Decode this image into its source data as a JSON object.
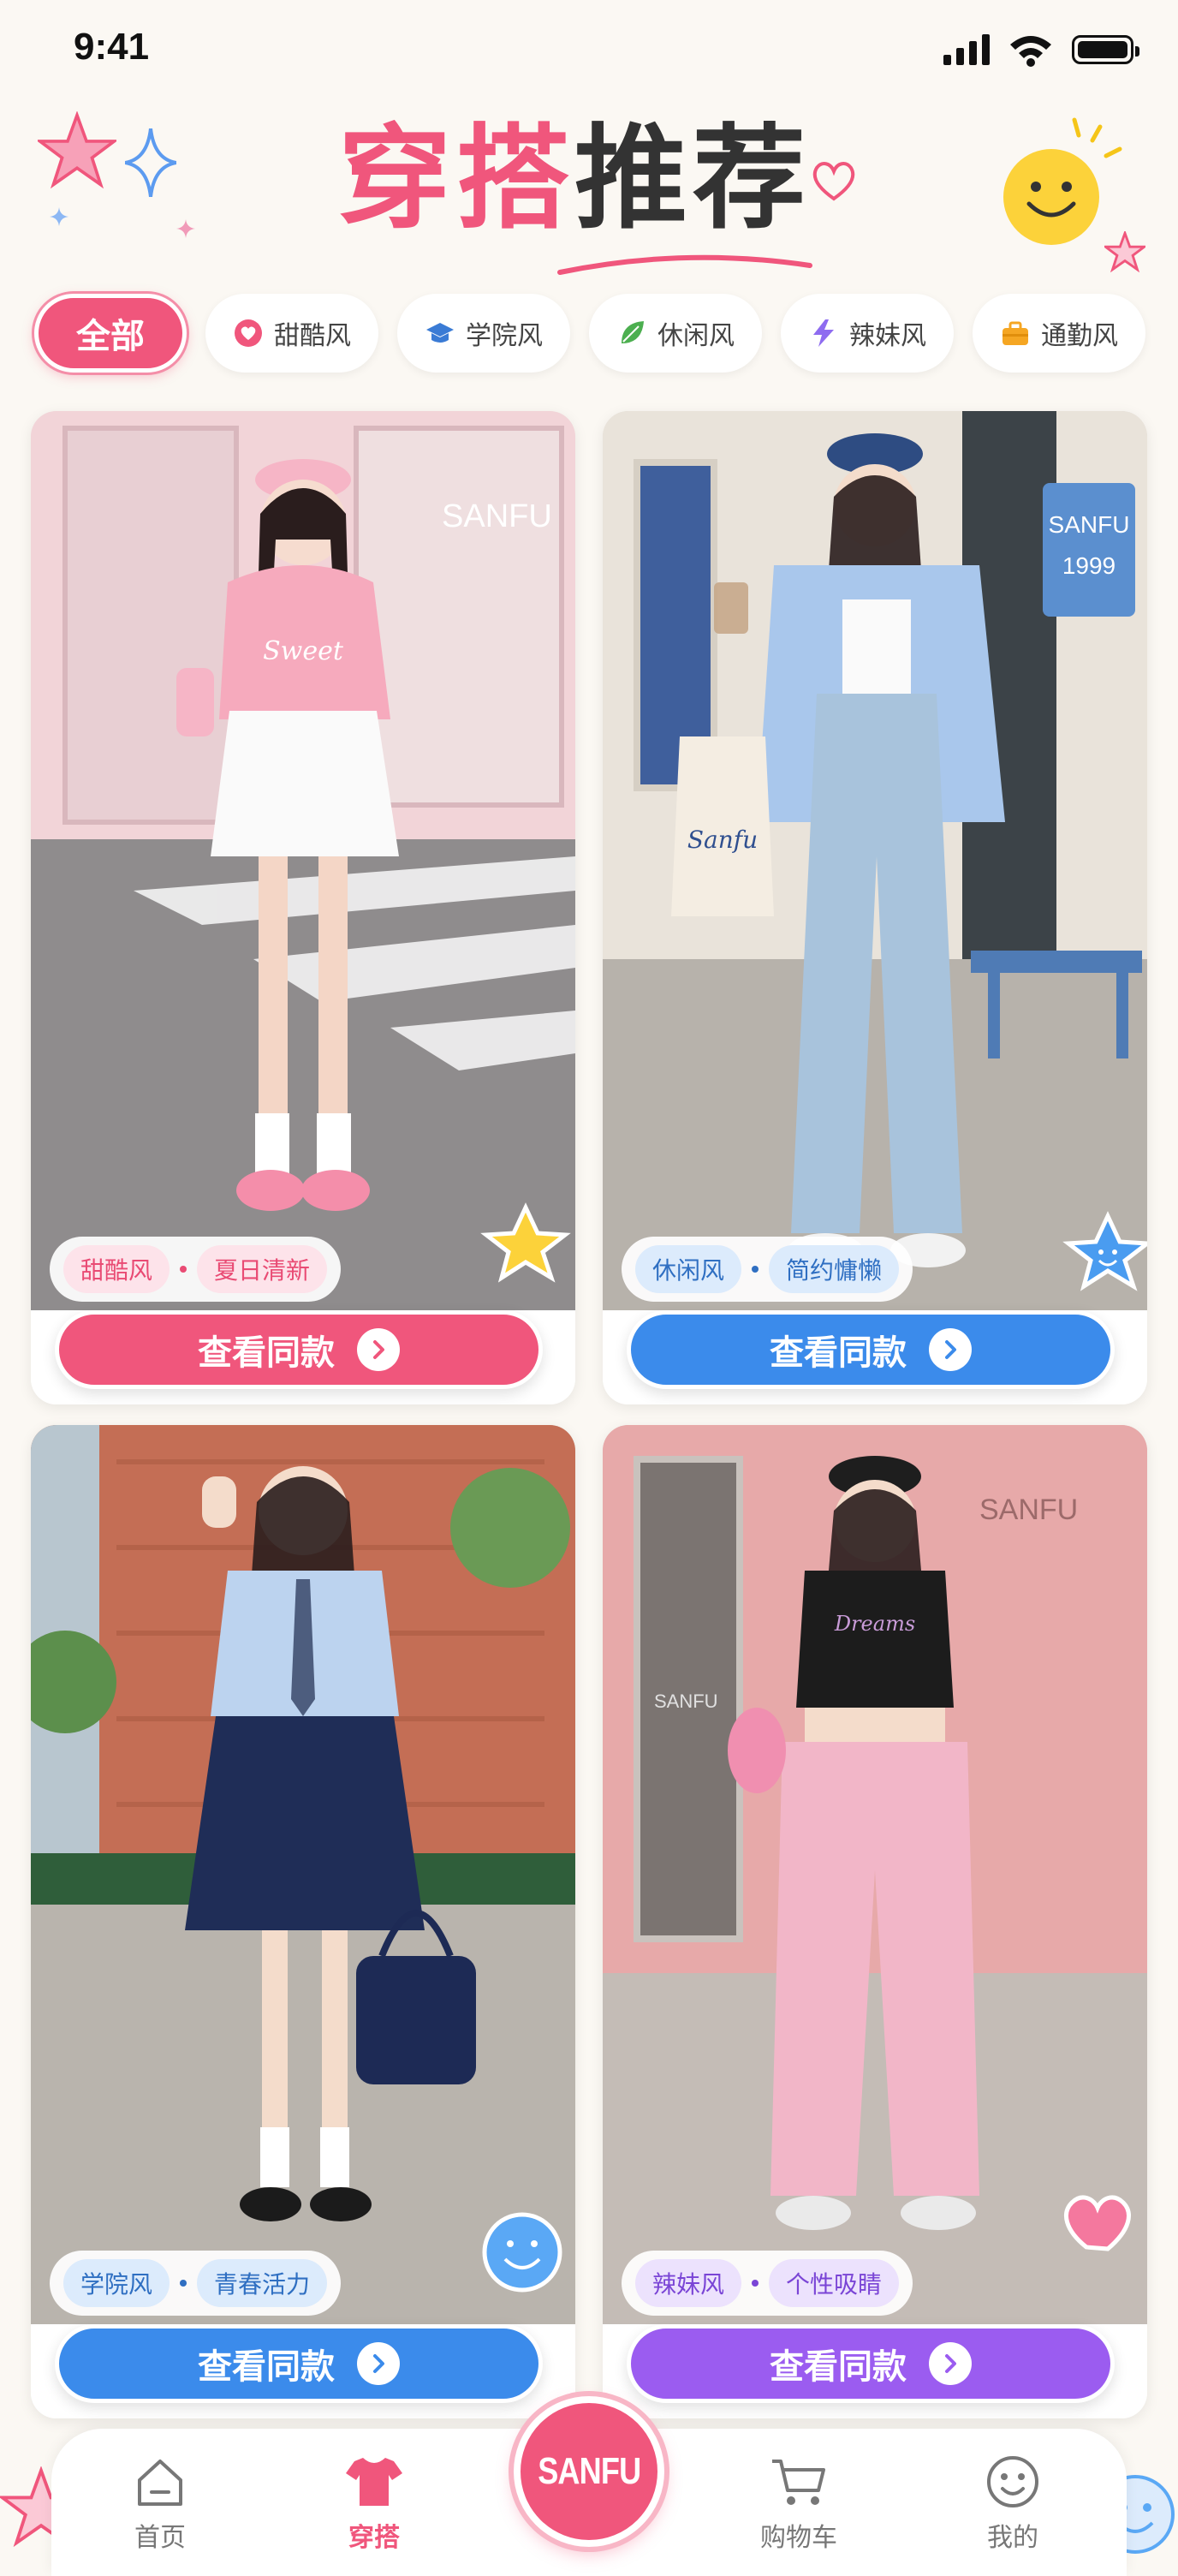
{
  "status_bar": {
    "time": "9:41"
  },
  "header": {
    "title_part1": "穿搭",
    "title_part2": "推荐"
  },
  "filters": [
    {
      "label": "全部",
      "icon": "none",
      "active": true
    },
    {
      "label": "甜酷风",
      "icon": "heart-icon",
      "color": "#f0567c"
    },
    {
      "label": "学院风",
      "icon": "graduation-cap-icon",
      "color": "#3a7bd5"
    },
    {
      "label": "休闲风",
      "icon": "leaf-icon",
      "color": "#4caf50"
    },
    {
      "label": "辣妹风",
      "icon": "lightning-icon",
      "color": "#8e6cf0"
    },
    {
      "label": "通勤风",
      "icon": "briefcase-icon",
      "color": "#f5a623"
    }
  ],
  "cards": [
    {
      "tag1": "甜酷风",
      "tag2": "夏日清新",
      "cta": "查看同款",
      "accent": "#f0567c",
      "tag_bg": "#fde3ea",
      "tag_color": "#e94b74",
      "storefront_text": "SANFU"
    },
    {
      "tag1": "休闲风",
      "tag2": "简约慵懒",
      "cta": "查看同款",
      "accent": "#3b8beb",
      "tag_bg": "#dcebfc",
      "tag_color": "#2f6fc2",
      "storefront_text": "SANFU",
      "storefront_text_2": "1999",
      "bag_text": "Sanfu"
    },
    {
      "tag1": "学院风",
      "tag2": "青春活力",
      "cta": "查看同款",
      "accent": "#3b8beb",
      "tag_bg": "#dcebfc",
      "tag_color": "#2f6fc2"
    },
    {
      "tag1": "辣妹风",
      "tag2": "个性吸睛",
      "cta": "查看同款",
      "accent": "#9b5cf0",
      "tag_bg": "#ece2fd",
      "tag_color": "#7a45d6",
      "storefront_text": "SANFU",
      "storefront_text_2": "SANFU"
    }
  ],
  "tabbar": {
    "items": [
      {
        "label": "首页",
        "icon": "home-icon"
      },
      {
        "label": "穿搭",
        "icon": "tshirt-icon",
        "active": true
      },
      {
        "label": "购物车",
        "icon": "cart-icon"
      },
      {
        "label": "我的",
        "icon": "smiley-icon"
      }
    ],
    "center_logo": "SANFU"
  },
  "colors": {
    "brand_pink": "#f0567c",
    "background": "#fbf8f3"
  }
}
